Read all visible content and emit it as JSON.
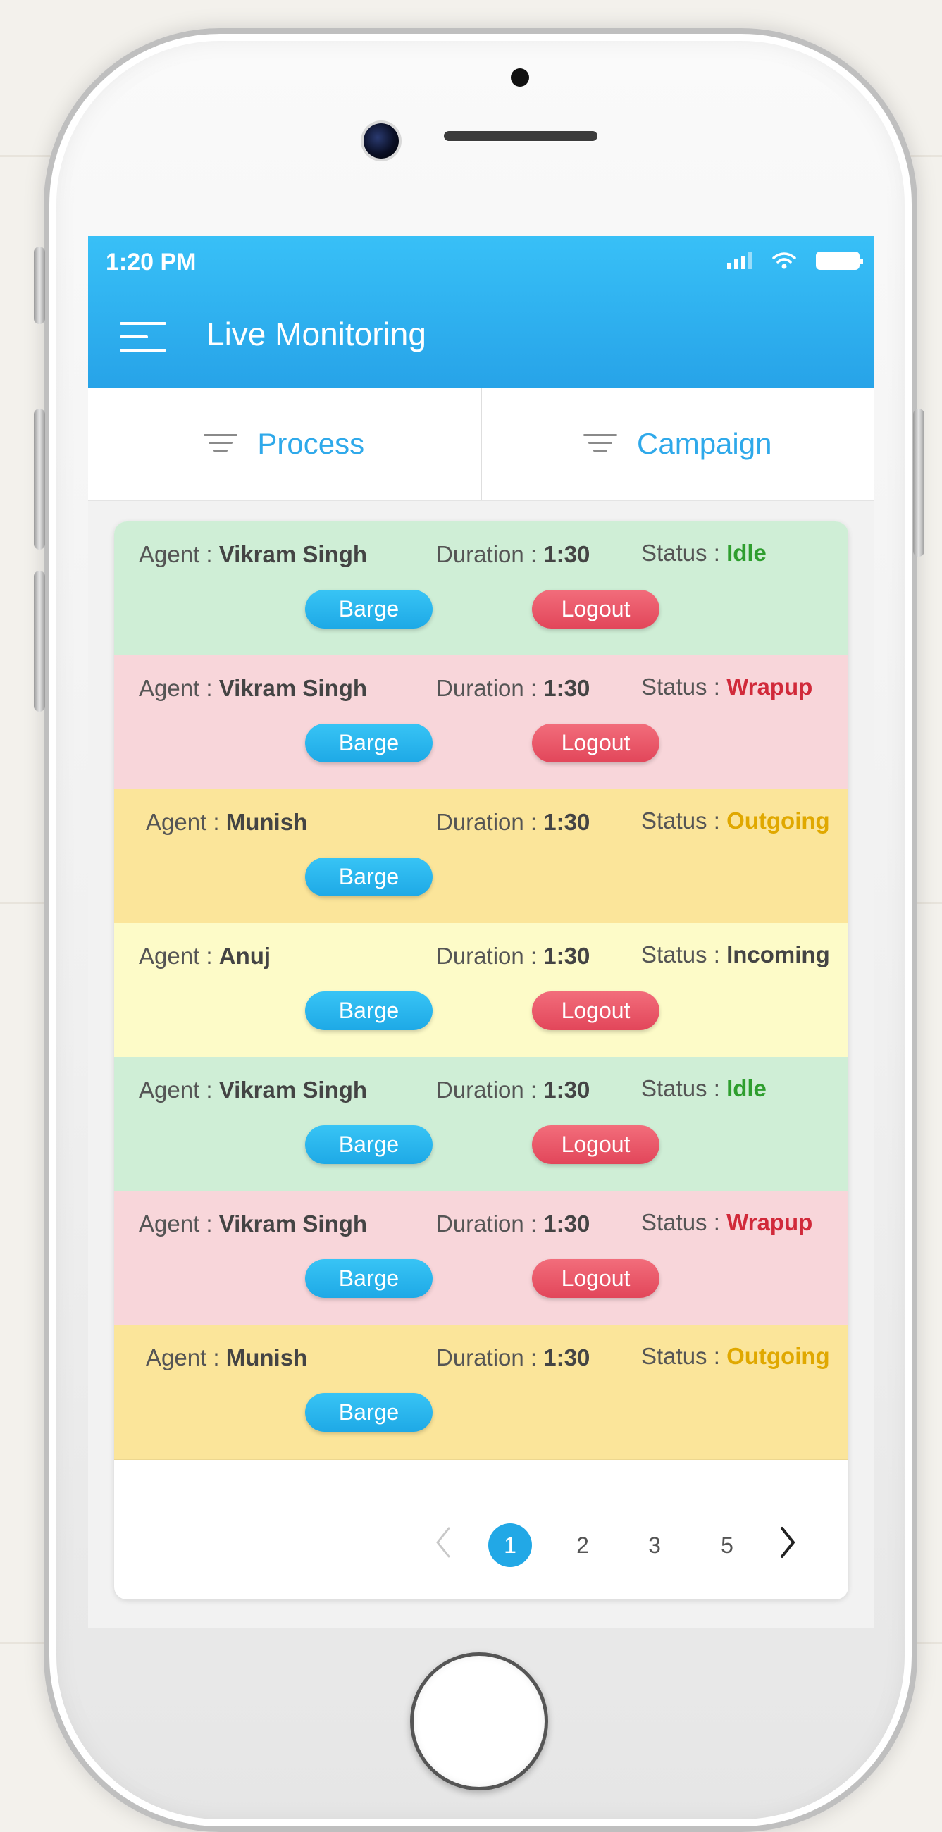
{
  "status_bar": {
    "time": "1:20 PM"
  },
  "header": {
    "title": "Live Monitoring"
  },
  "filters": [
    {
      "label": "Process"
    },
    {
      "label": "Campaign"
    }
  ],
  "labels": {
    "agent": "Agent : ",
    "duration": "Duration : ",
    "status": "Status : ",
    "barge": "Barge",
    "logout": "Logout"
  },
  "rows": [
    {
      "agent": "Vikram Singh",
      "duration": "1:30",
      "status": "Idle"
    },
    {
      "agent": "Vikram Singh",
      "duration": "1:30",
      "status": "Wrapup"
    },
    {
      "agent": "Munish",
      "duration": "1:30",
      "status": "Outgoing"
    },
    {
      "agent": "Anuj",
      "duration": "1:30",
      "status": "Incoming"
    },
    {
      "agent": "Vikram Singh",
      "duration": "1:30",
      "status": "Idle"
    },
    {
      "agent": "Vikram Singh",
      "duration": "1:30",
      "status": "Wrapup"
    },
    {
      "agent": "Munish",
      "duration": "1:30",
      "status": "Outgoing"
    }
  ],
  "pagination": {
    "pages": [
      "1",
      "2",
      "3",
      "5"
    ],
    "current": "1"
  },
  "colors": {
    "header": "#2ab0ef",
    "idle_bg": "#cfeed6",
    "wrapup_bg": "#f8d6da",
    "outgoing_bg": "#fbe59a",
    "incoming_bg": "#fdfbc8",
    "idle_text": "#2e9e2e",
    "wrapup_text": "#d12a3a",
    "outgoing_text": "#e0a800",
    "incoming_text": "#444444",
    "barge_button": "#25aeea",
    "logout_button": "#e8505f"
  },
  "icons": [
    "menu-icon",
    "filter-icon",
    "signal-icon",
    "wifi-icon",
    "battery-icon",
    "chevron-left-icon",
    "chevron-right-icon"
  ]
}
